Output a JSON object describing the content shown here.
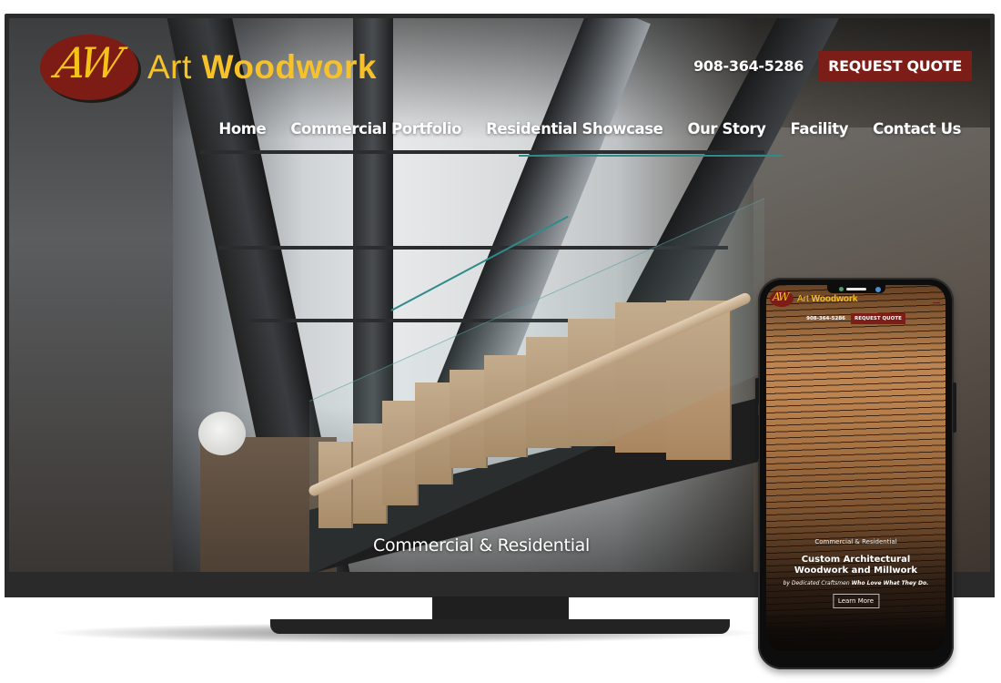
{
  "desktop": {
    "logo": {
      "monogram": "AW",
      "brand_light": "Art ",
      "brand_bold": "Woodwork"
    },
    "phone_number": "908-364-5286",
    "request_quote_label": "REQUEST QUOTE",
    "nav": [
      {
        "label": "Home"
      },
      {
        "label": "Commercial Portfolio"
      },
      {
        "label": "Residential Showcase"
      },
      {
        "label": "Our Story"
      },
      {
        "label": "Facility"
      },
      {
        "label": "Contact Us"
      }
    ],
    "hero_tagline": "Commercial & Residential"
  },
  "mobile": {
    "logo": {
      "monogram": "AW",
      "brand_light": "Art ",
      "brand_bold": "Woodwork"
    },
    "phone_number": "908-364-5286",
    "request_quote_label": "REQUEST QUOTE",
    "menu_icon": "hamburger-icon",
    "hero_tagline": "Commercial & Residential",
    "hero_title_line1": "Custom Architectural",
    "hero_title_line2": "Woodwork and Millwork",
    "hero_sub_light": "by Dedicated Craftsmen ",
    "hero_sub_bold": "Who Love What They Do.",
    "cta_label": "Learn More"
  },
  "colors": {
    "brand_gold": "#f7c12a",
    "brand_red": "#7c1d18",
    "bezel": "#2b2b2b"
  }
}
